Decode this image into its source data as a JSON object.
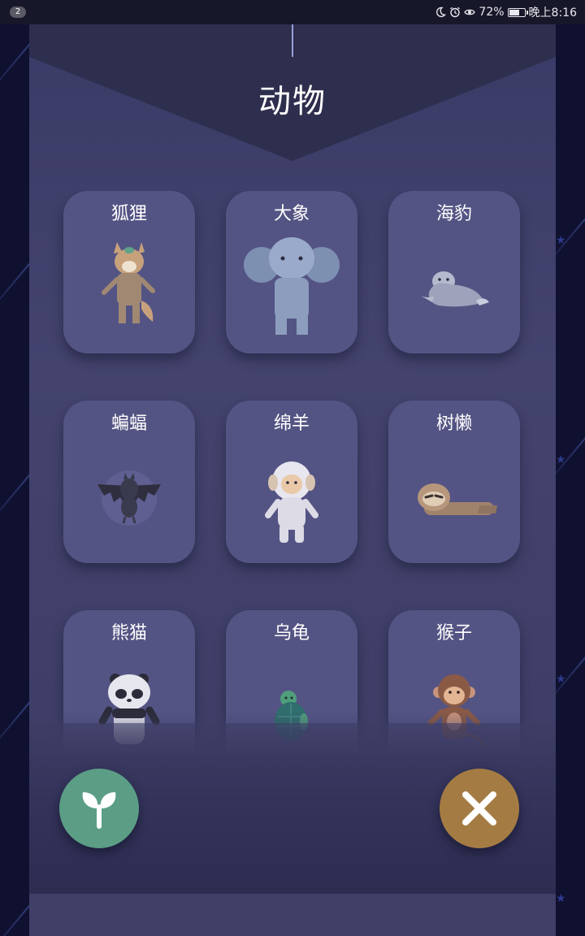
{
  "status_bar": {
    "notification_count": "2",
    "battery_percent": "72%",
    "battery_level": 0.72,
    "time": "晚上8:16",
    "icons": [
      "moon-icon",
      "alarm-icon",
      "eye-icon",
      "battery-icon"
    ]
  },
  "header": {
    "title": "动物"
  },
  "animals": [
    {
      "label": "狐狸",
      "icon": "fox-icon"
    },
    {
      "label": "大象",
      "icon": "elephant-icon"
    },
    {
      "label": "海豹",
      "icon": "seal-icon"
    },
    {
      "label": "蝙蝠",
      "icon": "bat-icon"
    },
    {
      "label": "绵羊",
      "icon": "sheep-icon"
    },
    {
      "label": "树懒",
      "icon": "sloth-icon"
    },
    {
      "label": "熊猫",
      "icon": "panda-icon"
    },
    {
      "label": "乌龟",
      "icon": "turtle-icon"
    },
    {
      "label": "猴子",
      "icon": "monkey-icon"
    }
  ],
  "actions": {
    "plant_icon": "sprout-icon",
    "close_icon": "close-icon"
  },
  "colors": {
    "panel": "#43436e",
    "card": "#545484",
    "plant_button": "#5b9e85",
    "close_button": "#a47c43"
  }
}
